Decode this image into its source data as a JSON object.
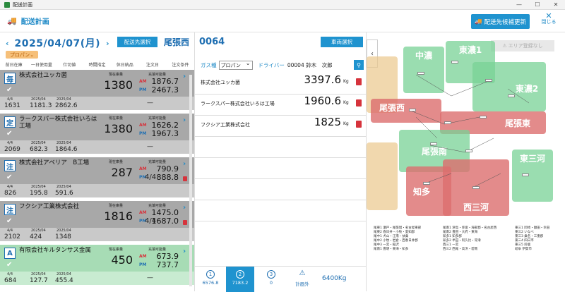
{
  "window": {
    "title": "配送計画"
  },
  "topbar": {
    "title": "配送計画",
    "update_label": "配送先候補更新",
    "close_label": "閉じる"
  },
  "left": {
    "date": "2025/04/07(月)",
    "select_label": "配送先選択",
    "area": "尾張西",
    "gas_badge": "プロパン",
    "columns": [
      "前日在庫",
      "一日使用量",
      "仕切値",
      "時間指定",
      "休日納品",
      "注文日",
      "注文条件"
    ],
    "cards": [
      {
        "tag": "毎",
        "name": "株式会社ユッカ菌",
        "current_label": "現在庫量",
        "current": "1380",
        "capacity_label": "充填可能量",
        "am": "1876.7",
        "pm": "2467.3",
        "stats": [
          {
            "l": "4/4",
            "v": "1631"
          },
          {
            "l": "2025/04",
            "v": "1181.3"
          },
          {
            "l": "2025/04",
            "v": "2862.6"
          }
        ],
        "frac": "",
        "dash": "—"
      },
      {
        "tag": "定",
        "name": "ラークスパー株式会社いろは工場",
        "current_label": "現在庫量",
        "current": "1380",
        "capacity_label": "充填可能量",
        "am": "1626.2",
        "pm": "1967.3",
        "stats": [
          {
            "l": "4/4",
            "v": "2069"
          },
          {
            "l": "2025/04",
            "v": "682.3"
          },
          {
            "l": "2025/04",
            "v": "1864.6"
          }
        ],
        "frac": "",
        "dash": "—"
      },
      {
        "tag": "注",
        "name": "株式会社アベリア　B工場",
        "current_label": "現在庫量",
        "current": "287",
        "capacity_label": "充填可能量",
        "am": "790.9",
        "pm": "888.8",
        "stats": [
          {
            "l": "4/4",
            "v": "826"
          },
          {
            "l": "2025/04",
            "v": "195.8"
          },
          {
            "l": "2025/04",
            "v": "591.6"
          }
        ],
        "frac": "4/4",
        "dash": ""
      },
      {
        "tag": "注",
        "name": "フクシア工業株式会社",
        "current_label": "現在庫量",
        "current": "1816",
        "capacity_label": "充填可能量",
        "am": "1475.0",
        "pm": "1687.0",
        "stats": [
          {
            "l": "4/4",
            "v": "2102"
          },
          {
            "l": "2025/04",
            "v": "424"
          },
          {
            "l": "2025/04",
            "v": "1348"
          }
        ],
        "frac": "4/4",
        "dash": ""
      },
      {
        "tag": "A",
        "name": "有限会社キルタンサス金属",
        "current_label": "現在庫量",
        "current": "450",
        "capacity_label": "充填可能量",
        "am": "673.9",
        "pm": "737.7",
        "stats": [
          {
            "l": "4/4",
            "v": "684"
          },
          {
            "l": "2025/04",
            "v": "127.7"
          },
          {
            "l": "2025/04",
            "v": "455.4"
          }
        ],
        "frac": "",
        "dash": "—"
      }
    ]
  },
  "mid": {
    "code": "0064",
    "vehicle_label": "車両選択",
    "gas_label": "ガス種",
    "gas_value": "プロパン",
    "driver_label": "ドライバー",
    "driver_value": "00004 鈴木　次郎",
    "rows": [
      {
        "name": "株式会社ユッカ菌",
        "qty": "3397.6",
        "unit": "Kg"
      },
      {
        "name": "ラークスパー株式会社いろは工場",
        "qty": "1960.6",
        "unit": "Kg"
      },
      {
        "name": "フクシア工業株式会社",
        "qty": "1825",
        "unit": "Kg"
      }
    ],
    "tabs": [
      {
        "num": "1",
        "val": "6576.8"
      },
      {
        "num": "2",
        "val": "7183.2"
      },
      {
        "num": "3",
        "val": "0"
      },
      {
        "num": "⚠",
        "val": "計画外"
      }
    ],
    "total": "6400Kg"
  },
  "map": {
    "no_area_label": "エリア登録なし",
    "zones": [
      {
        "name": "中濃",
        "color": "green"
      },
      {
        "name": "東濃1",
        "color": "green"
      },
      {
        "name": "東濃2",
        "color": "green"
      },
      {
        "name": "尾張西",
        "color": "red"
      },
      {
        "name": "尾張東",
        "color": "red"
      },
      {
        "name": "尾張南",
        "color": "green"
      },
      {
        "name": "東三河",
        "color": "green"
      },
      {
        "name": "知多",
        "color": "red"
      },
      {
        "name": "西三河",
        "color": "red"
      }
    ],
    "legend": [
      [
        "尾東1 瀬戸・尾張旭・名古屋東部",
        "尾東2 春日井・小牧・愛知郡",
        "尾中1 犬山・江南・扶桑",
        "尾中2 小牧・岩倉・西春日井郡",
        "尾中3 一宮・稲沢",
        "尾南1 豊明・東海・知多"
      ],
      [
        "尾南1 津島・弥富・海部郡・名古屋西",
        "尾南2 豊田・大府・東海",
        "知多1 知多郡",
        "知多2 半田・阿久比・常滑",
        "西三1 一宮",
        "西三2 西尾・高浜・碧南"
      ],
      [
        "東三1 岡崎・額田・幸田",
        "東三2 いなべ",
        "東三3 桑名・三重郡",
        "東三4 四日市",
        "東三5 鈴鹿",
        "岐阜 伊賀市"
      ]
    ]
  }
}
